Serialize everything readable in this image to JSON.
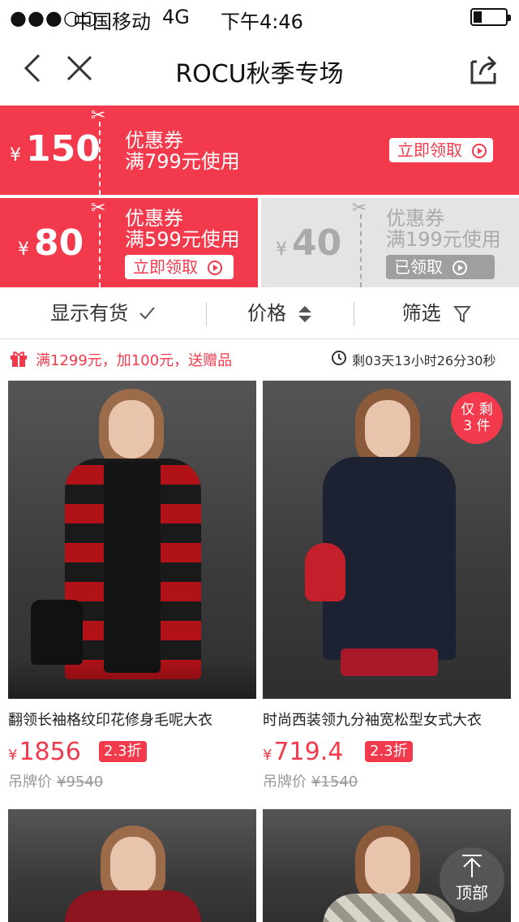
{
  "status_bar": {
    "signal": "●●●○○",
    "carrier": "中国移动",
    "network": "4G",
    "time": "下午4:46"
  },
  "nav": {
    "title": "ROCU秋季专场"
  },
  "coupons": [
    {
      "currency": "¥",
      "amount": "150",
      "label": "优惠券",
      "condition": "满799元使用",
      "button": "立即领取",
      "state": "available"
    },
    {
      "currency": "¥",
      "amount": "80",
      "label": "优惠券",
      "condition": "满599元使用",
      "button": "立即领取",
      "state": "available"
    },
    {
      "currency": "¥",
      "amount": "40",
      "label": "优惠券",
      "condition": "满199元使用",
      "button": "已领取",
      "state": "claimed"
    }
  ],
  "filters": {
    "in_stock": "显示有货",
    "price": "价格",
    "filter": "筛选"
  },
  "promo": {
    "text": "满1299元，加100元，送赠品",
    "countdown": "剩03天13小时26分30秒"
  },
  "products": [
    {
      "name": "翻领长袖格纹印花修身毛呢大衣",
      "currency": "¥",
      "price": "1856",
      "discount": "2.3折",
      "orig_label": "吊牌价",
      "orig_price": "¥9540"
    },
    {
      "name": "时尚西装领九分袖宽松型女式大衣",
      "currency": "¥",
      "price": "719.4",
      "discount": "2.3折",
      "orig_label": "吊牌价",
      "orig_price": "¥1540",
      "badge_line1": "仅 剩",
      "badge_line2": "3 件"
    }
  ],
  "back_to_top": "顶部",
  "colors": {
    "accent": "#f33a4c",
    "claimed": "#e4e4e4"
  }
}
